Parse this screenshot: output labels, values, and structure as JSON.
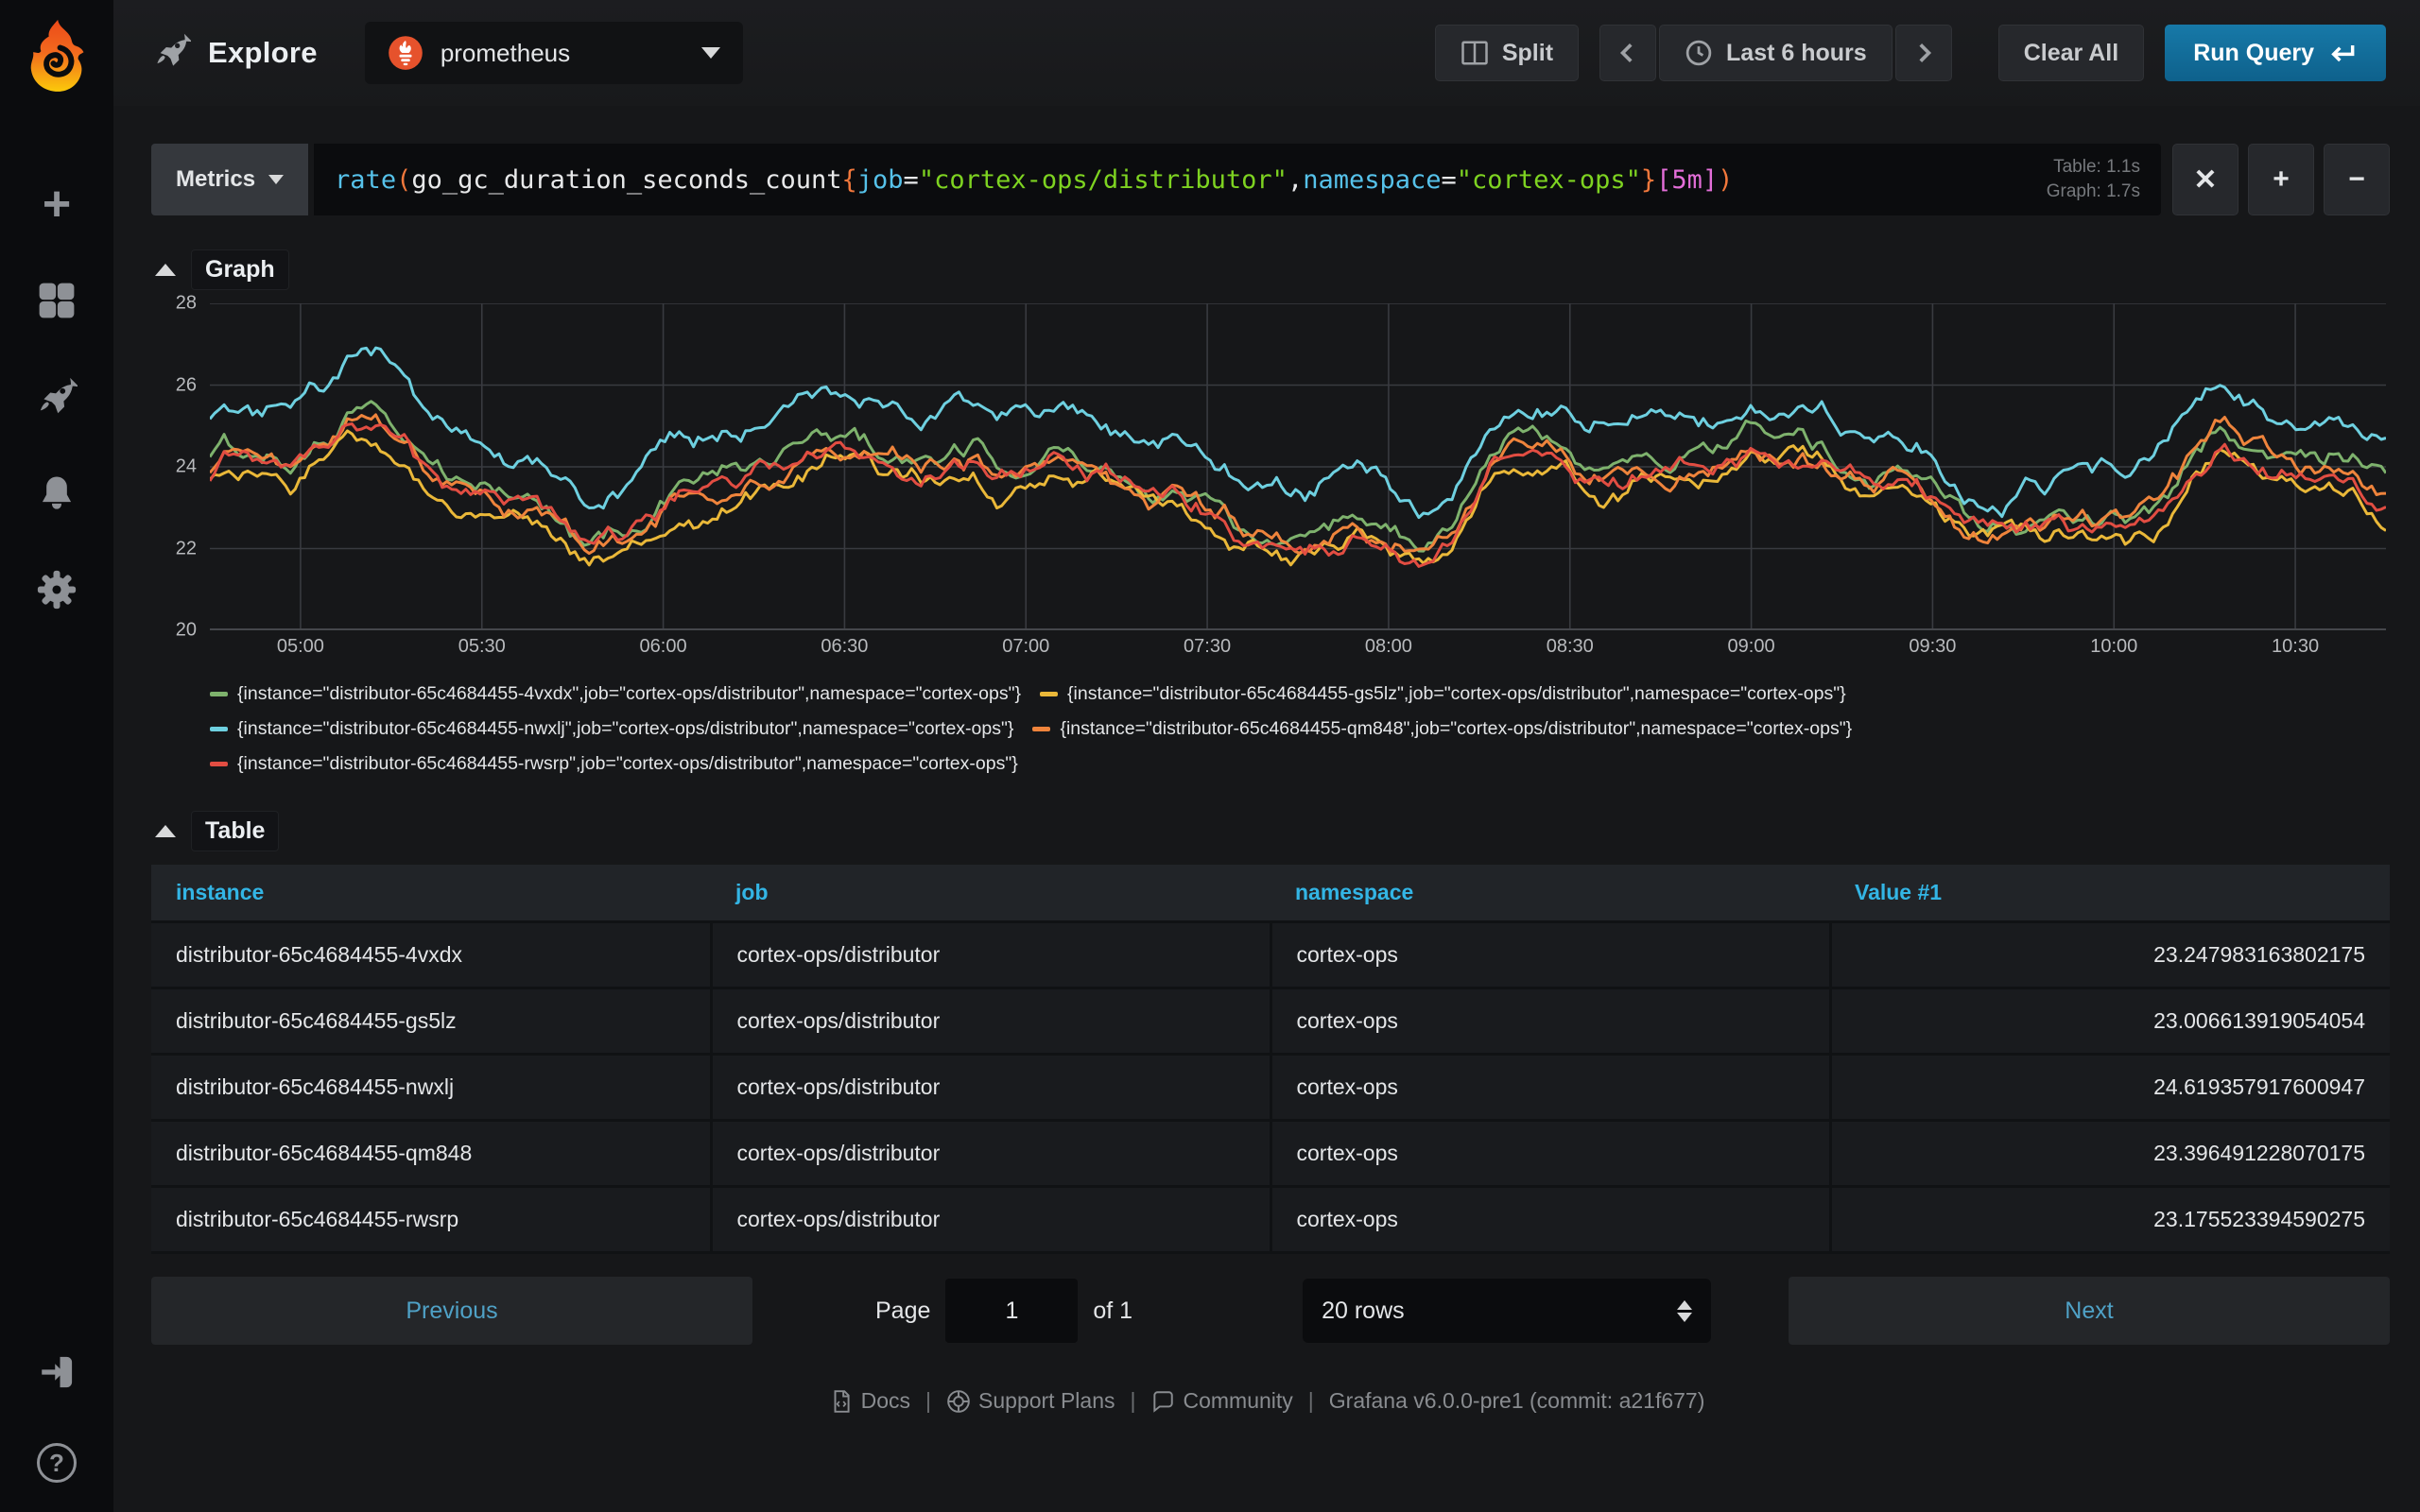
{
  "sidebar": {
    "icons": [
      "plus",
      "dashboards",
      "explore",
      "alerting",
      "configuration"
    ],
    "bottom_icons": [
      "sign-in",
      "help"
    ]
  },
  "topbar": {
    "title": "Explore",
    "datasource": "prometheus",
    "split_label": "Split",
    "time_range": "Last 6 hours",
    "clear_all_label": "Clear All",
    "run_query_label": "Run Query"
  },
  "query": {
    "mode_label": "Metrics",
    "tokens": [
      {
        "t": "rate",
        "c": "fn"
      },
      {
        "t": "(",
        "c": "p"
      },
      {
        "t": "go_gc_duration_seconds_count",
        "c": "plain"
      },
      {
        "t": "{",
        "c": "p"
      },
      {
        "t": "job",
        "c": "key"
      },
      {
        "t": "=",
        "c": "plain"
      },
      {
        "t": "\"cortex-ops/distributor\"",
        "c": "str"
      },
      {
        "t": ",",
        "c": "plain"
      },
      {
        "t": "namespace",
        "c": "key"
      },
      {
        "t": "=",
        "c": "plain"
      },
      {
        "t": "\"cortex-ops\"",
        "c": "str"
      },
      {
        "t": "}",
        "c": "p"
      },
      {
        "t": "[5m]",
        "c": "dur"
      },
      {
        "t": ")",
        "c": "p"
      }
    ],
    "timing_table": "Table: 1.1s",
    "timing_graph": "Graph: 1.7s",
    "remove_label": "x",
    "add_label": "+",
    "collapse_label": "-"
  },
  "graph_section": {
    "title": "Graph"
  },
  "chart_data": {
    "type": "line",
    "title": "",
    "xlabel": "",
    "ylabel": "",
    "ylim": [
      20,
      28
    ],
    "y_ticks": [
      20,
      22,
      24,
      26,
      28
    ],
    "x_ticks": [
      "05:00",
      "05:30",
      "06:00",
      "06:30",
      "07:00",
      "07:30",
      "08:00",
      "08:30",
      "09:00",
      "09:30",
      "10:00",
      "10:30"
    ],
    "x_range_hours": 6,
    "first_tick_offset_hours": 0.25,
    "tick_step_hours": 0.5,
    "grid": true,
    "legend_position": "bottom",
    "series": [
      {
        "name": "{instance=\"distributor-65c4684455-4vxdx\",job=\"cortex-ops/distributor\",namespace=\"cortex-ops\"}",
        "color": "#7EB26D",
        "base": 23.55,
        "scale": 0.95,
        "mean_value": 23.247983163802175
      },
      {
        "name": "{instance=\"distributor-65c4684455-gs5lz\",job=\"cortex-ops/distributor\",namespace=\"cortex-ops\"}",
        "color": "#EAB839",
        "base": 23.0,
        "scale": 0.9,
        "mean_value": 23.006613919054054
      },
      {
        "name": "{instance=\"distributor-65c4684455-nwxlj\",job=\"cortex-ops/distributor\",namespace=\"cortex-ops\"}",
        "color": "#6ED0E0",
        "base": 24.55,
        "scale": 1.0,
        "mean_value": 24.619357917600947
      },
      {
        "name": "{instance=\"distributor-65c4684455-qm848\",job=\"cortex-ops/distributor\",namespace=\"cortex-ops\"}",
        "color": "#EF843C",
        "base": 23.3,
        "scale": 0.92,
        "mean_value": 23.396491228070175
      },
      {
        "name": "{instance=\"distributor-65c4684455-rwsrp\",job=\"cortex-ops/distributor\",namespace=\"cortex-ops\"}",
        "color": "#E24D42",
        "base": 23.2,
        "scale": 0.95,
        "mean_value": 23.175523394590275
      }
    ]
  },
  "table_section": {
    "title": "Table",
    "columns": [
      "instance",
      "job",
      "namespace",
      "Value #1"
    ],
    "rows": [
      [
        "distributor-65c4684455-4vxdx",
        "cortex-ops/distributor",
        "cortex-ops",
        "23.247983163802175"
      ],
      [
        "distributor-65c4684455-gs5lz",
        "cortex-ops/distributor",
        "cortex-ops",
        "23.006613919054054"
      ],
      [
        "distributor-65c4684455-nwxlj",
        "cortex-ops/distributor",
        "cortex-ops",
        "24.619357917600947"
      ],
      [
        "distributor-65c4684455-qm848",
        "cortex-ops/distributor",
        "cortex-ops",
        "23.396491228070175"
      ],
      [
        "distributor-65c4684455-rwsrp",
        "cortex-ops/distributor",
        "cortex-ops",
        "23.175523394590275"
      ]
    ]
  },
  "pagination": {
    "previous_label": "Previous",
    "page_label": "Page",
    "page_value": "1",
    "of_label": "of 1",
    "rows_option": "20 rows",
    "next_label": "Next"
  },
  "footer": {
    "docs_label": "Docs",
    "support_label": "Support Plans",
    "community_label": "Community",
    "version": "Grafana v6.0.0-pre1 (commit: a21f677)"
  }
}
